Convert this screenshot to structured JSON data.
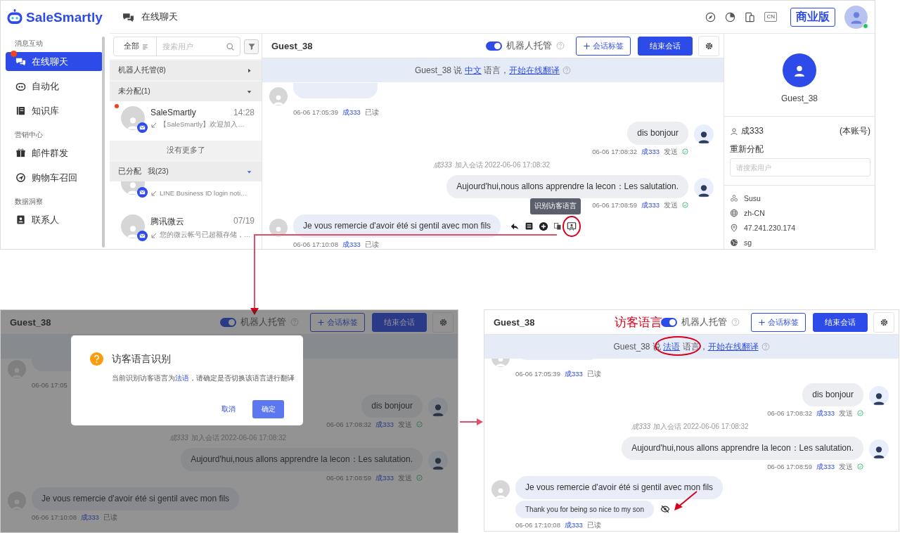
{
  "top": {
    "logo": "SaleSmartly",
    "title": "在线聊天",
    "tools": [
      {
        "kind": "compass"
      },
      {
        "kind": "pie"
      },
      {
        "kind": "devices"
      },
      {
        "kind": "lang",
        "label": "CN"
      }
    ],
    "edition": "商业版",
    "online": true
  },
  "nav": [
    {
      "heading": "消息互动",
      "items": [
        {
          "kind": "chat",
          "label": "在线聊天",
          "selected": true,
          "unread": true
        },
        {
          "kind": "robot",
          "label": "自动化",
          "selected": false,
          "unread": false
        },
        {
          "kind": "book",
          "label": "知识库",
          "selected": false,
          "unread": false
        }
      ]
    },
    {
      "heading": "营销中心",
      "items": [
        {
          "kind": "gift",
          "label": "邮件群发",
          "selected": false,
          "unread": false
        },
        {
          "kind": "recall",
          "label": "购物车召回",
          "selected": false,
          "unread": false
        }
      ]
    },
    {
      "heading": "数据洞察",
      "items": [
        {
          "kind": "contact",
          "label": "联系人",
          "selected": false,
          "unread": false
        }
      ]
    }
  ],
  "conversations": {
    "filter": "全部",
    "search_placeholder": "搜索用户",
    "groups": [
      {
        "title": "机器人托管(8)",
        "expanded": false,
        "color": "#444444"
      },
      {
        "title": "未分配(1)",
        "expanded": true,
        "color": "#444444",
        "items": [
          {
            "name": "SaleSmartly",
            "time": "14:28",
            "preview": "【SaleSmartly】欢迎加入…",
            "unread": true
          }
        ],
        "footer": "没有更多了"
      },
      {
        "title": "已分配",
        "owner": "我(23)",
        "expanded": true,
        "color": "#2c6be8",
        "items": [
          {
            "preview": "LINE Business ID login noti…",
            "unread": false
          },
          {
            "name": "腾讯微云",
            "time": "07/19",
            "preview": "您的微云帐号已超额存储，…",
            "unread": false
          }
        ]
      }
    ]
  },
  "main_chat": {
    "header": {
      "name": "Guest_38",
      "bot_label": "机器人托管",
      "bot_on": true,
      "tag_button": "会话标签",
      "end_button": "结束会话"
    },
    "banner": {
      "visitor": "Guest_38",
      "verb": "说",
      "language": "中文",
      "after": "语言，",
      "action": "开始在线翻译",
      "highlighted": false
    },
    "messages": [
      {
        "kind": "visitor",
        "time": "06-06 17:05:39",
        "agent": "成333",
        "status": "已读"
      },
      {
        "kind": "agent",
        "text": "dis bonjour",
        "time": "06-06 17:08:32",
        "agent": "成333",
        "status": "发送",
        "delivered": true
      },
      {
        "kind": "system",
        "agent": "成333",
        "text": "加入会话 2022-06-06 17:08:32"
      },
      {
        "kind": "agent",
        "text": "Aujourd'hui,nous allons apprendre la lecon：Les salutation.",
        "time": "06-06 17:08:59",
        "agent": "成333",
        "status": "发送",
        "delivered": true
      },
      {
        "kind": "visitor",
        "text": "Je vous remercie d'avoir été si gentil avec mon fils",
        "time": "06-06 17:10:08",
        "agent": "成333",
        "status": "已读",
        "actions": true,
        "tooltip": "识别访客语言"
      }
    ]
  },
  "visitor_info": {
    "name": "Guest_38",
    "owner": "成333",
    "owner_note": "(本账号)",
    "reassign": "重新分配",
    "reassign_placeholder": "请搜索用户",
    "attributes": [
      {
        "kind": "name",
        "value": "Susu"
      },
      {
        "kind": "language",
        "value": "zh-CN"
      },
      {
        "kind": "ip",
        "value": "47.241.230.174"
      },
      {
        "kind": "region",
        "value": "sg"
      }
    ]
  },
  "confirm_view": {
    "header": {
      "name": "Guest_38",
      "bot_label": "机器人托管",
      "bot_on": true,
      "tag_button": "会话标签",
      "end_button": "结束会话"
    },
    "messages": [
      {
        "kind": "visitor",
        "time": "06-06 17:05"
      },
      {
        "kind": "agent",
        "text": "dis bonjour",
        "time": "06-06 17:08:32",
        "agent": "成333",
        "status": "发送",
        "delivered": true
      },
      {
        "kind": "system",
        "agent": "成333",
        "text": "加入会话 2022-06-06 17:08:32"
      },
      {
        "kind": "agent",
        "text": "Aujourd'hui,nous allons apprendre la lecon：Les salutation.",
        "time": "06-06 17:08:59",
        "agent": "成333",
        "status": "发送",
        "delivered": true
      },
      {
        "kind": "visitor",
        "text": "Je vous remercie d'avoir été si gentil avec mon fils",
        "time": "06-06 17:10:08",
        "agent": "成333",
        "status": "已读"
      }
    ],
    "modal": {
      "title": "访客语言识别",
      "before": "当前识别访客语言为",
      "language": "法语",
      "after": "，请确定是否切换该语言进行翻译",
      "cancel": "取消",
      "confirm": "确定"
    }
  },
  "result_view": {
    "header": {
      "name": "Guest_38",
      "bot_label": "机器人托管",
      "bot_on": true,
      "tag_button": "会话标签",
      "end_button": "结束会话"
    },
    "callout": "访客语言",
    "banner": {
      "visitor": "Guest_38",
      "verb": "说",
      "language": "法语",
      "after": "语言，",
      "action": "开始在线翻译",
      "highlighted": true
    },
    "messages": [
      {
        "kind": "visitor",
        "time": "06-06 17:05:39",
        "agent": "成333",
        "status": "已读"
      },
      {
        "kind": "agent",
        "text": "dis bonjour",
        "time": "06-06 17:08:32",
        "agent": "成333",
        "status": "发送",
        "delivered": true
      },
      {
        "kind": "system",
        "agent": "成333",
        "text": "加入会话 2022-06-06 17:08:32"
      },
      {
        "kind": "agent",
        "text": "Aujourd'hui,nous allons apprendre la lecon：Les salutation.",
        "time": "06-06 17:08:59",
        "agent": "成333",
        "status": "发送",
        "delivered": true
      },
      {
        "kind": "visitor",
        "text": "Je vous remercie d'avoir été si gentil avec mon fils",
        "translation": "Thank you for being so nice to my son",
        "time": "06-06 17:10:08",
        "agent": "成333",
        "status": "已读"
      }
    ]
  }
}
